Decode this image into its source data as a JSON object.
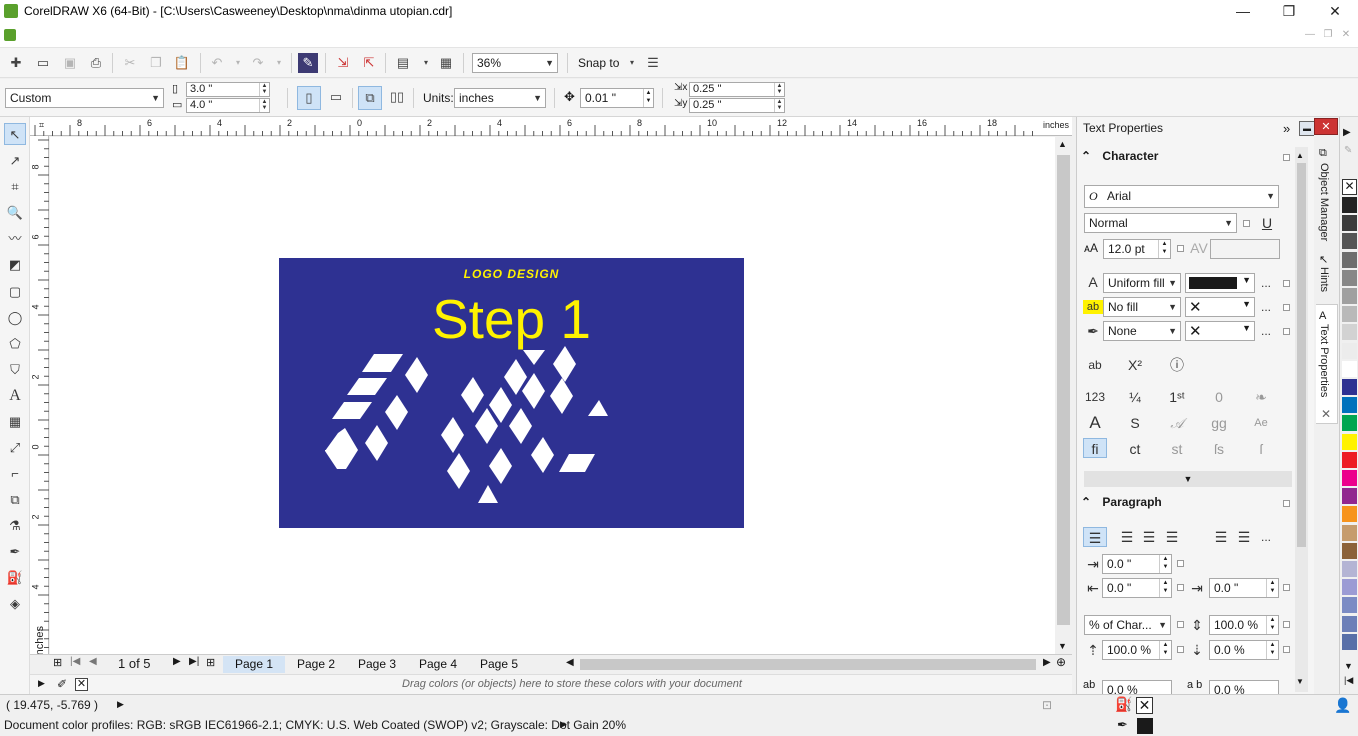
{
  "window": {
    "title": "CorelDRAW X6 (64-Bit) - [C:\\Users\\Casweeney\\Desktop\\nma\\dinma utopian.cdr]",
    "minimize": "—",
    "maximize": "❐",
    "close": "✕"
  },
  "standard_toolbar": {
    "zoom_value": "36%",
    "snap_label": "Snap to"
  },
  "property_bar": {
    "page_size": "Custom",
    "width": "3.0 \"",
    "height": "4.0 \"",
    "units_label": "Units:",
    "units_value": "inches",
    "nudge": "0.01 \"",
    "dup_x": "0.25 \"",
    "dup_y": "0.25 \""
  },
  "rulers": {
    "h_labels": [
      "8",
      "6",
      "4",
      "2",
      "0",
      "2",
      "4",
      "6",
      "8",
      "10",
      "12",
      "14",
      "16",
      "18"
    ],
    "h_unit": "inches",
    "v_labels": [
      "8",
      "6",
      "4",
      "2",
      "0",
      "2",
      "4",
      "6"
    ],
    "v_unit": "inches"
  },
  "design": {
    "tagline": "LOGO DESIGN",
    "headline": "Step 1",
    "bg_color": "#2e3192",
    "text_color": "#fff200"
  },
  "pages": {
    "counter": "1 of 5",
    "tabs": [
      "Page 1",
      "Page 2",
      "Page 3",
      "Page 4",
      "Page 5"
    ],
    "active": "Page 1"
  },
  "tray_hint": "Drag colors (or objects) here to store these colors with your document",
  "docker": {
    "title": "Text Properties",
    "character_label": "Character",
    "font": "Arial",
    "font_style": "Normal",
    "font_size": "12.0 pt",
    "fill_type": "Uniform fill",
    "bg_fill": "No fill",
    "outline": "None",
    "paragraph_label": "Paragraph",
    "indent_first": "0.0 \"",
    "indent_left": "0.0 \"",
    "indent_right": "0.0 \"",
    "spacing_unit": "% of Char...",
    "line_spacing": "100.0 %",
    "char_spacing": "100.0 %",
    "word_spacing": "0.0 %",
    "before_spacing": "0.0 %",
    "after_spacing": "0.0 %"
  },
  "side_tabs": [
    "Object Manager",
    "Hints",
    "Text Properties"
  ],
  "palette_colors": [
    "#222222",
    "#3c3c3c",
    "#555555",
    "#6e6e6e",
    "#878787",
    "#a0a0a0",
    "#b9b9b9",
    "#d2d2d2",
    "#ececec",
    "#ffffff",
    "#2e3192",
    "#0072bc",
    "#00a651",
    "#fff200",
    "#ed1c24",
    "#ec008c",
    "#92278f",
    "#f7941d",
    "#c69c6d",
    "#8c6239",
    "#b4b4d4",
    "#9b9bd4",
    "#7b8bc4",
    "#6c7fb8",
    "#586fa8"
  ],
  "status": {
    "coords": "( 19.475, -5.769 )",
    "profiles": "Document color profiles: RGB: sRGB IEC61966-2.1; CMYK: U.S. Web Coated (SWOP) v2; Grayscale: Dot Gain 20%"
  }
}
